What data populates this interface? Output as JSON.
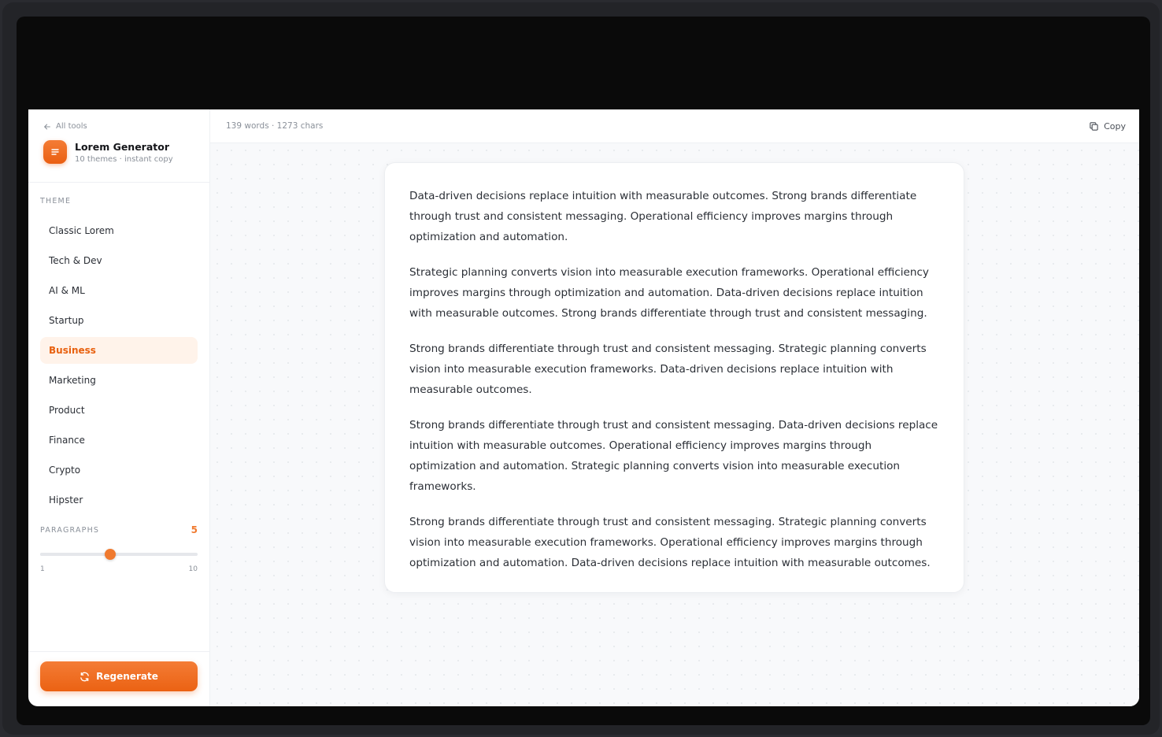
{
  "sidebar": {
    "back_label": "All tools",
    "app_title": "Lorem Generator",
    "app_subtitle": "10 themes · instant copy",
    "theme_section_label": "THEME",
    "themes": [
      {
        "label": "Classic Lorem"
      },
      {
        "label": "Tech & Dev"
      },
      {
        "label": "AI & ML"
      },
      {
        "label": "Startup"
      },
      {
        "label": "Business"
      },
      {
        "label": "Marketing"
      },
      {
        "label": "Product"
      },
      {
        "label": "Finance"
      },
      {
        "label": "Crypto"
      },
      {
        "label": "Hipster"
      }
    ],
    "selected_theme": "Business",
    "paragraphs_label": "PARAGRAPHS",
    "paragraphs_value": "5",
    "slider": {
      "min": 1,
      "max": 10,
      "value": 5,
      "min_label": "1",
      "max_label": "10"
    },
    "regenerate_label": "Regenerate"
  },
  "topbar": {
    "stats": "139 words · 1273 chars",
    "copy_label": "Copy"
  },
  "output": {
    "paragraphs": [
      "Data-driven decisions replace intuition with measurable outcomes. Strong brands differentiate through trust and consistent messaging. Operational efficiency improves margins through optimization and automation.",
      "Strategic planning converts vision into measurable execution frameworks. Operational efficiency improves margins through optimization and automation. Data-driven decisions replace intuition with measurable outcomes. Strong brands differentiate through trust and consistent messaging.",
      "Strong brands differentiate through trust and consistent messaging. Strategic planning converts vision into measurable execution frameworks. Data-driven decisions replace intuition with measurable outcomes.",
      "Strong brands differentiate through trust and consistent messaging. Data-driven decisions replace intuition with measurable outcomes. Operational efficiency improves margins through optimization and automation. Strategic planning converts vision into measurable execution frameworks.",
      "Strong brands differentiate through trust and consistent messaging. Strategic planning converts vision into measurable execution frameworks. Operational efficiency improves margins through optimization and automation. Data-driven decisions replace intuition with measurable outcomes."
    ]
  },
  "colors": {
    "accent": "#f07a2f",
    "accent_bg": "#fff3ea"
  },
  "icons": {
    "back": "arrow-left-icon",
    "logo": "text-lines-icon",
    "copy": "copy-icon",
    "regenerate": "refresh-icon"
  }
}
